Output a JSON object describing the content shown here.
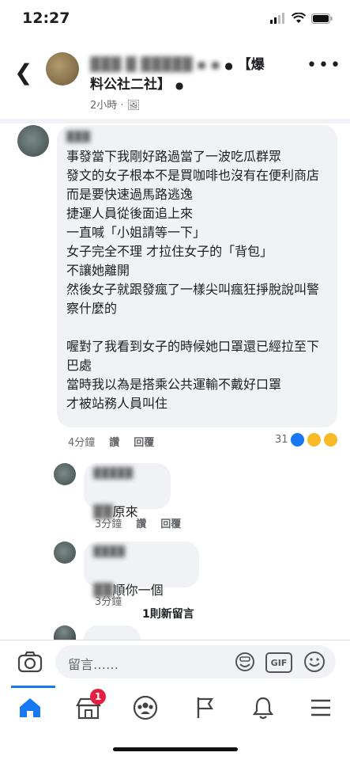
{
  "status": {
    "time": "12:27"
  },
  "post": {
    "title": "▓▓▓ ▓ ▓▓▓▓▓ ▪ ▪ ● 【爆料公社二社】 ●",
    "title_visible": "【爆料公社二社】",
    "time": "2小時",
    "more": "..."
  },
  "comments": [
    {
      "name": "▓▓▓",
      "text": "事發當下我剛好路過當了一波吃瓜群眾\n發文的女子根本不是買咖啡也沒有在便利商店\n而是要快速過馬路逃逸\n捷運人員從後面追上來\n一直喊「小姐請等一下」\n女子完全不理 才拉住女子的「背包」\n不讓她離開\n然後女子就跟發瘋了一樣尖叫瘋狂掙脫說叫警察什麼的\n\n喔對了我看到女子的時候她口罩還已經拉至下巴處\n當時我以為是搭乘公共運輸不戴好口罩\n才被站務人員叫住",
      "time": "4分鐘",
      "like": "讚",
      "reply": "回覆",
      "reactions": "31"
    }
  ],
  "replies": [
    {
      "name": "▓▓▓▓▓",
      "text": "原來",
      "time": "3分鐘",
      "like": "讚",
      "reply": "回覆"
    },
    {
      "name": "▓▓▓▓",
      "text": "順你一個",
      "time": "3分鐘"
    }
  ],
  "new_comments": "1則新留言",
  "composer": {
    "placeholder": "留言……",
    "gif": "GIF"
  },
  "nav": {
    "badge": "1"
  }
}
